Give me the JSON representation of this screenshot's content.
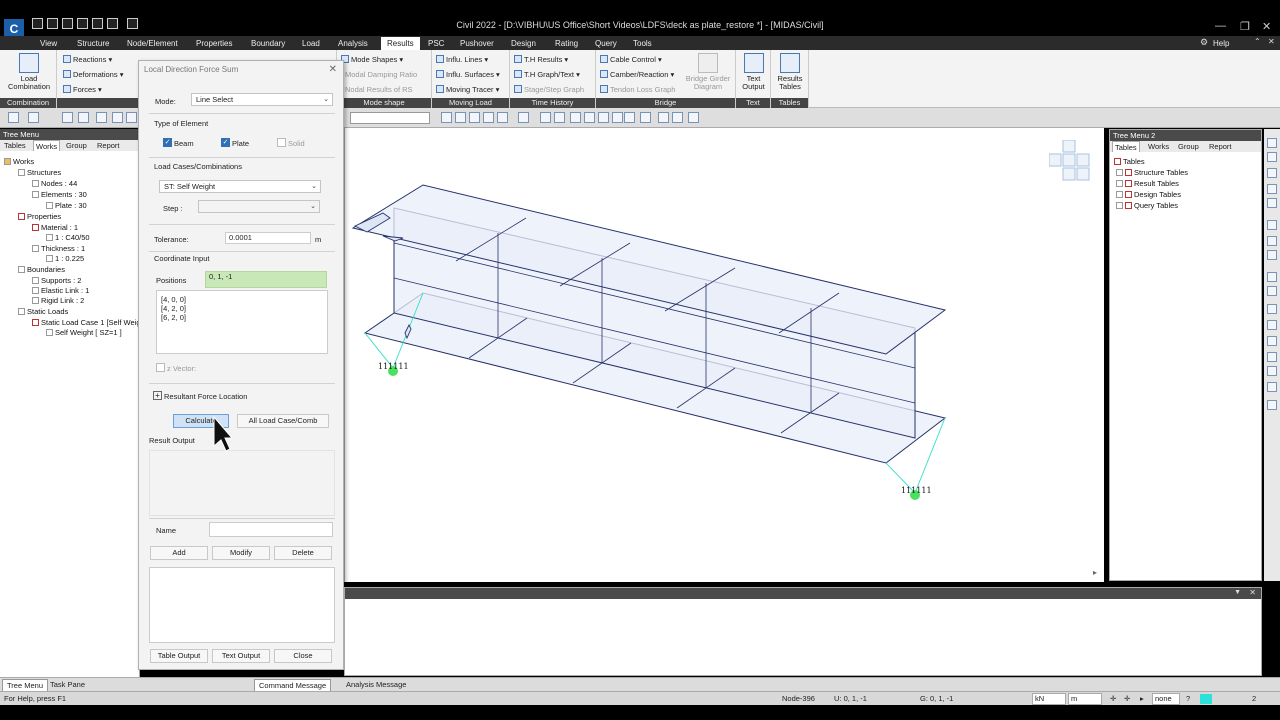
{
  "app": {
    "title": "Civil 2022 - [D:\\VIBHU\\US Office\\Short Videos\\LDFS\\deck as plate_restore *] - [MIDAS/Civil]",
    "help": "Help"
  },
  "menu": [
    {
      "label": "View"
    },
    {
      "label": "Structure"
    },
    {
      "label": "Node/Element"
    },
    {
      "label": "Properties"
    },
    {
      "label": "Boundary"
    },
    {
      "label": "Load"
    },
    {
      "label": "Analysis"
    },
    {
      "label": "Results"
    },
    {
      "label": "PSC"
    },
    {
      "label": "Pushover"
    },
    {
      "label": "Design"
    },
    {
      "label": "Rating"
    },
    {
      "label": "Query"
    },
    {
      "label": "Tools"
    }
  ],
  "ribbon": {
    "load_combination": "Load Combination",
    "combination_group": "Combination",
    "reactions": "Reactions",
    "deformations": "Deformations",
    "forces": "Forces",
    "mode_shapes": "Mode Shapes",
    "modal_damping": "Modal Damping Ratio",
    "nodal_results": "Nodal Results of RS",
    "mode_shape_group": "Mode shape",
    "influ_lines": "Influ. Lines",
    "influ_surfaces": "Influ. Surfaces",
    "moving_tracer": "Moving Tracer",
    "moving_load_group": "Moving Load",
    "th_results": "T.H Results",
    "th_graph": "T.H Graph/Text",
    "stage_graph": "Stage/Step Graph",
    "time_history_group": "Time History",
    "cable_control": "Cable Control",
    "camber_reaction": "Camber/Reaction",
    "tendon_loss": "Tendon Loss Graph",
    "bridge_girder": "Bridge Girder Diagram",
    "bridge_group": "Bridge",
    "text_output": "Text Output",
    "text_group": "Text",
    "results_tables": "Results Tables",
    "tables_group": "Tables"
  },
  "left_tree": {
    "header": "Tree Menu",
    "tabs": [
      "Tables",
      "Works",
      "Group",
      "Report"
    ],
    "nodes": [
      "Works",
      "Structures",
      "Nodes : 44",
      "Elements : 30",
      "Plate : 30",
      "Properties",
      "Material : 1",
      "1 : C40/50",
      "Thickness : 1",
      "1 : 0.225",
      "Boundaries",
      "Supports : 2",
      "Elastic Link : 1",
      "Rigid Link : 2",
      "Static Loads",
      "Static Load Case 1 [Self Weig",
      "Self Weight [ SZ=1 ]"
    ]
  },
  "dialog": {
    "title": "Local Direction Force Sum",
    "mode_label": "Mode:",
    "mode_value": "Line Select",
    "type_label": "Type of Element",
    "beam": "Beam",
    "plate": "Plate",
    "solid": "Solid",
    "lc_label": "Load Cases/Combinations",
    "lc_value": "ST: Self Weight",
    "step_label": "Step :",
    "tolerance_label": "Tolerance:",
    "tolerance_value": "0.0001",
    "tolerance_unit": "m",
    "coord_label": "Coordinate Input",
    "positions_label": "Positions",
    "positions_value": "0, 1, -1",
    "positions_list": [
      "[4, 0, 0]",
      "[4, 2, 0]",
      "[6, 2, 0]"
    ],
    "zvector": "z Vector:",
    "resultant": "Resultant Force Location",
    "calculate": "Calculate",
    "all_load": "All Load Case/Comb",
    "result_output": "Result Output",
    "name_label": "Name",
    "add": "Add",
    "modify": "Modify",
    "delete": "Delete",
    "table_output": "Table Output",
    "text_output": "Text Output",
    "close": "Close"
  },
  "viewport": {
    "support_label_1": "111111",
    "support_label_2": "111111"
  },
  "right_tree": {
    "header": "Tree Menu 2",
    "tabs": [
      "Tables",
      "Works",
      "Group",
      "Report"
    ],
    "nodes": [
      "Tables",
      "Structure Tables",
      "Result Tables",
      "Design Tables",
      "Query Tables"
    ]
  },
  "bottom_tabs": {
    "tree_menu": "Tree Menu",
    "task_pane": "Task Pane",
    "command_message": "Command Message",
    "analysis_message": "Analysis Message"
  },
  "status": {
    "help": "For Help, press F1",
    "node": "Node-396",
    "u": "U: 0, 1, -1",
    "g": "G: 0, 1, -1",
    "force_unit": "kN",
    "length_unit": "m",
    "none": "none",
    "page": "2"
  }
}
